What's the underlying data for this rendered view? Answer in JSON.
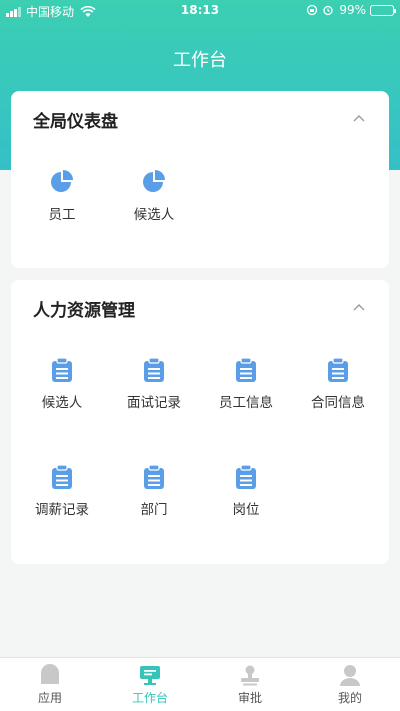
{
  "status_bar": {
    "carrier": "中国移动",
    "time": "18:13",
    "battery": "99%"
  },
  "header": {
    "title": "工作台"
  },
  "sections": [
    {
      "title": "全局仪表盘",
      "items": [
        {
          "label": "员工",
          "icon": "pie-chart-icon"
        },
        {
          "label": "候选人",
          "icon": "pie-chart-icon"
        }
      ]
    },
    {
      "title": "人力资源管理",
      "items": [
        {
          "label": "候选人",
          "icon": "clipboard-icon"
        },
        {
          "label": "面试记录",
          "icon": "clipboard-icon"
        },
        {
          "label": "员工信息",
          "icon": "clipboard-icon"
        },
        {
          "label": "合同信息",
          "icon": "clipboard-icon"
        },
        {
          "label": "调薪记录",
          "icon": "clipboard-icon"
        },
        {
          "label": "部门",
          "icon": "clipboard-icon"
        },
        {
          "label": "岗位",
          "icon": "clipboard-icon"
        }
      ]
    }
  ],
  "tabs": [
    {
      "label": "应用",
      "icon": "home-icon",
      "active": false
    },
    {
      "label": "工作台",
      "icon": "desk-icon",
      "active": true
    },
    {
      "label": "审批",
      "icon": "stamp-icon",
      "active": false
    },
    {
      "label": "我的",
      "icon": "user-icon",
      "active": false
    }
  ],
  "colors": {
    "accent": "#35c4b8",
    "header_gradient_top": "#3ccfb2",
    "header_gradient_bottom": "#35c0c8",
    "icon_blue": "#5b9ee8"
  }
}
